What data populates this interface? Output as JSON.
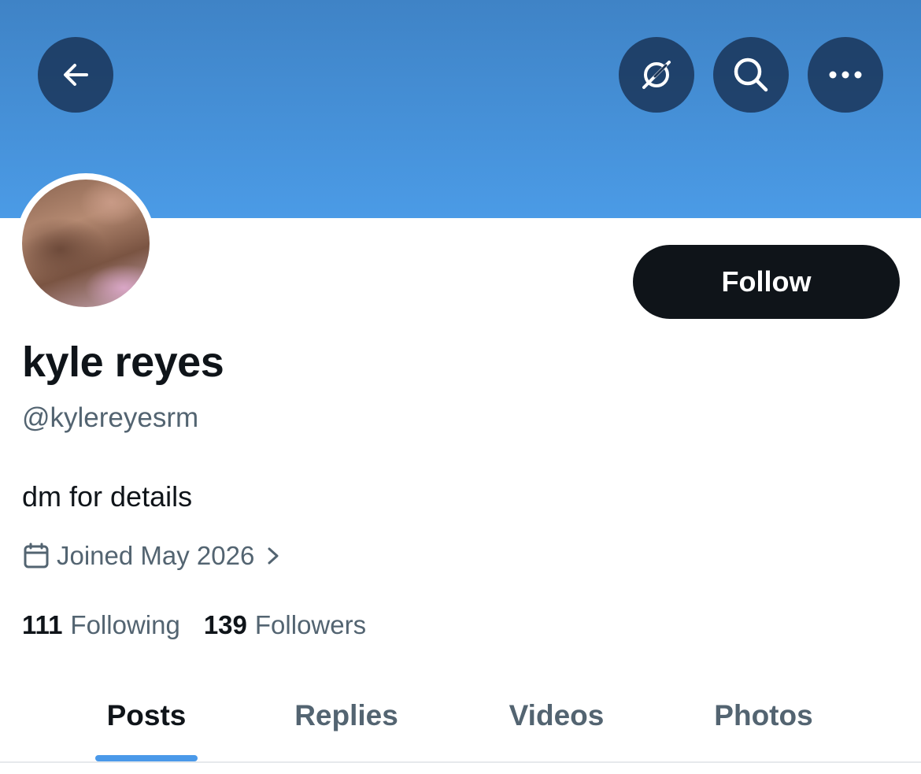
{
  "header": {
    "back_icon": "arrow-left-icon",
    "grok_icon": "grok-icon",
    "search_icon": "search-icon",
    "more_icon": "more-horizontal-icon",
    "banner_color": "#4a99e6"
  },
  "profile": {
    "display_name": "kyle reyes",
    "handle": "@kylereyesrm",
    "bio": "dm for details",
    "joined": "Joined May 2026",
    "follow_label": "Follow",
    "following_count": "111",
    "following_label": "Following",
    "followers_count": "139",
    "followers_label": "Followers"
  },
  "tabs": [
    {
      "label": "Posts",
      "active": true
    },
    {
      "label": "Replies",
      "active": false
    },
    {
      "label": "Videos",
      "active": false
    },
    {
      "label": "Photos",
      "active": false
    }
  ],
  "colors": {
    "accent": "#4a99e9",
    "primary_text": "#0f1419",
    "secondary_text": "#536471",
    "button_bg": "#0f1419"
  }
}
